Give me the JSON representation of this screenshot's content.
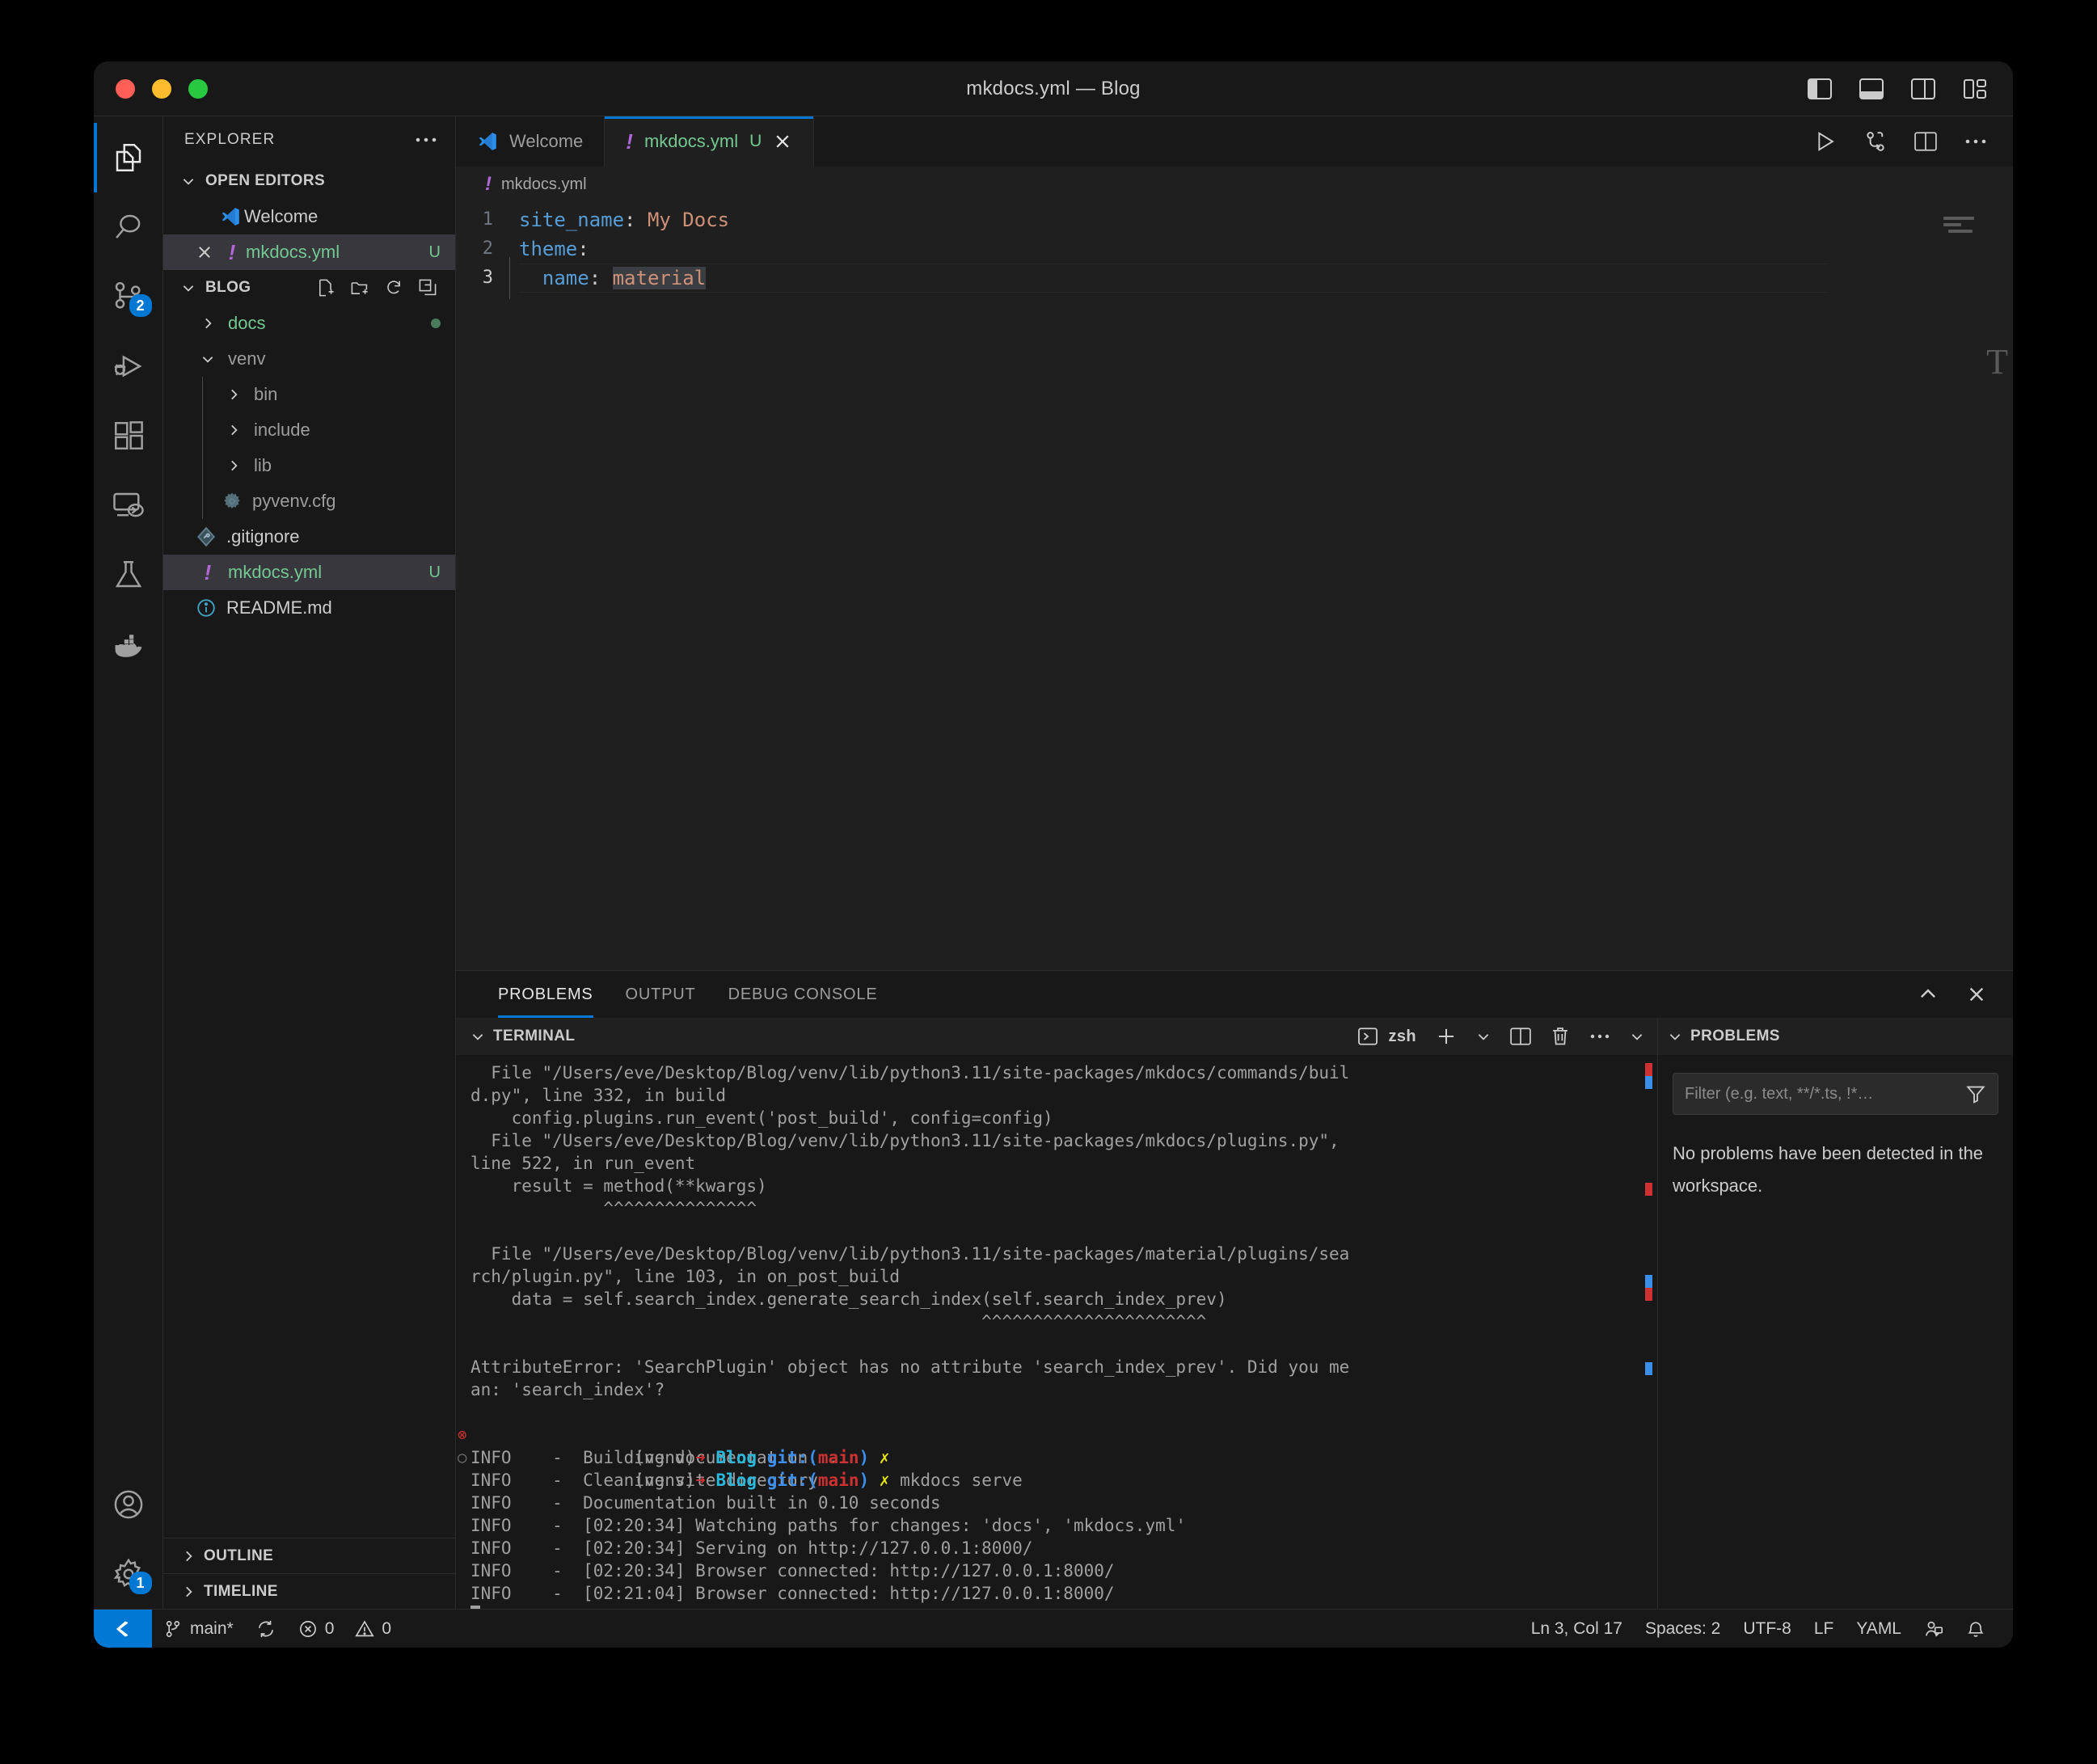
{
  "window": {
    "title": "mkdocs.yml — Blog",
    "traffic_lights": [
      "close",
      "minimize",
      "zoom"
    ],
    "layout_actions": [
      "toggle-primary-sidebar",
      "toggle-panel",
      "toggle-secondary-sidebar",
      "customize-layout"
    ]
  },
  "activitybar": {
    "items": [
      {
        "name": "explorer",
        "icon": "files-icon",
        "active": true,
        "badge": ""
      },
      {
        "name": "search",
        "icon": "search-icon",
        "active": false,
        "badge": ""
      },
      {
        "name": "source-control",
        "icon": "source-control-icon",
        "active": false,
        "badge": "2"
      },
      {
        "name": "run-and-debug",
        "icon": "debug-icon",
        "active": false,
        "badge": ""
      },
      {
        "name": "extensions",
        "icon": "extensions-icon",
        "active": false,
        "badge": ""
      },
      {
        "name": "remote-explorer",
        "icon": "remote-icon",
        "active": false,
        "badge": ""
      },
      {
        "name": "testing",
        "icon": "beaker-icon",
        "active": false,
        "badge": ""
      },
      {
        "name": "docker",
        "icon": "docker-icon",
        "active": false,
        "badge": ""
      }
    ],
    "bottom": [
      {
        "name": "accounts",
        "icon": "account-icon",
        "badge": ""
      },
      {
        "name": "manage",
        "icon": "gear-icon",
        "badge": "1"
      }
    ]
  },
  "sidebar": {
    "title": "EXPLORER",
    "more_actions": "…",
    "open_editors": {
      "label": "OPEN EDITORS",
      "expanded": true,
      "items": [
        {
          "label": "Welcome",
          "icon": "vscode-icon",
          "dirty": "",
          "selected": false,
          "close": false
        },
        {
          "label": "mkdocs.yml",
          "icon": "yaml-icon",
          "dirty": "U",
          "selected": true,
          "close": true
        }
      ]
    },
    "workspace": {
      "label": "BLOG",
      "expanded": true,
      "actions": [
        "new-file-icon",
        "new-folder-icon",
        "refresh-icon",
        "collapse-all-icon"
      ],
      "items": [
        {
          "label": "docs",
          "type": "folder",
          "expanded": false,
          "depth": 1,
          "color": "green",
          "decoration": "modified-dot"
        },
        {
          "label": "venv",
          "type": "folder",
          "expanded": true,
          "depth": 1,
          "color": "dim",
          "decoration": ""
        },
        {
          "label": "bin",
          "type": "folder",
          "expanded": false,
          "depth": 2,
          "color": "dim",
          "decoration": ""
        },
        {
          "label": "include",
          "type": "folder",
          "expanded": false,
          "depth": 2,
          "color": "dim",
          "decoration": ""
        },
        {
          "label": "lib",
          "type": "folder",
          "expanded": false,
          "depth": 2,
          "color": "dim",
          "decoration": ""
        },
        {
          "label": "pyvenv.cfg",
          "type": "file",
          "icon": "gear-file-icon",
          "depth": 2,
          "color": "dim",
          "decoration": ""
        },
        {
          "label": ".gitignore",
          "type": "file",
          "icon": "git-file-icon",
          "depth": 1,
          "color": "normal",
          "decoration": ""
        },
        {
          "label": "mkdocs.yml",
          "type": "file",
          "icon": "yaml-icon",
          "depth": 1,
          "color": "green",
          "decoration": "U",
          "selected": true
        },
        {
          "label": "README.md",
          "type": "file",
          "icon": "info-file-icon",
          "depth": 1,
          "color": "normal",
          "decoration": ""
        }
      ]
    },
    "collapsed_sections": [
      {
        "label": "OUTLINE"
      },
      {
        "label": "TIMELINE"
      }
    ]
  },
  "editor": {
    "tabs": [
      {
        "label": "Welcome",
        "icon": "vscode-icon",
        "active": false,
        "dirty": "",
        "closable": false
      },
      {
        "label": "mkdocs.yml",
        "icon": "yaml-icon",
        "active": true,
        "dirty": "U",
        "closable": true
      }
    ],
    "actions": [
      "run-icon",
      "split-merge-icon",
      "split-editor-icon",
      "more-actions-icon"
    ],
    "breadcrumb": {
      "icon": "yaml-icon",
      "path": "mkdocs.yml"
    },
    "lines": [
      {
        "num": "1",
        "tokens": [
          {
            "text": "site_name",
            "cls": "k-key"
          },
          {
            "text": ": ",
            "cls": "k-punc"
          },
          {
            "text": "My Docs",
            "cls": "k-str"
          }
        ]
      },
      {
        "num": "2",
        "tokens": [
          {
            "text": "theme",
            "cls": "k-key"
          },
          {
            "text": ":",
            "cls": "k-punc"
          }
        ]
      },
      {
        "num": "3",
        "tokens": [
          {
            "text": "  ",
            "cls": "k-punc"
          },
          {
            "text": "name",
            "cls": "k-key"
          },
          {
            "text": ": ",
            "cls": "k-punc"
          },
          {
            "text": "material",
            "cls": "k-str sel"
          }
        ]
      }
    ]
  },
  "panel": {
    "tabs": [
      {
        "label": "PROBLEMS",
        "active": true
      },
      {
        "label": "OUTPUT",
        "active": false
      },
      {
        "label": "DEBUG CONSOLE",
        "active": false
      }
    ],
    "actions": [
      "chevron-up-icon",
      "close-icon"
    ],
    "terminal": {
      "header_label": "TERMINAL",
      "shell_label": "zsh",
      "header_actions": [
        "new-terminal-icon",
        "terminal-dropdown-icon",
        "split-terminal-icon",
        "kill-terminal-icon",
        "more-actions-icon",
        "hide-panel-icon"
      ],
      "lines": [
        "  File \"/Users/eve/Desktop/Blog/venv/lib/python3.11/site-packages/mkdocs/commands/buil",
        "d.py\", line 332, in build",
        "    config.plugins.run_event('post_build', config=config)",
        "  File \"/Users/eve/Desktop/Blog/venv/lib/python3.11/site-packages/mkdocs/plugins.py\",",
        "line 522, in run_event",
        "    result = method(**kwargs)",
        "             ^^^^^^^^^^^^^^^",
        "",
        "  File \"/Users/eve/Desktop/Blog/venv/lib/python3.11/site-packages/material/plugins/sea",
        "rch/plugin.py\", line 103, in on_post_build",
        "    data = self.search_index.generate_search_index(self.search_index_prev)",
        "                                                  ^^^^^^^^^^^^^^^^^^^^^^",
        "",
        "AttributeError: 'SearchPlugin' object has no attribute 'search_index_prev'. Did you me",
        "an: 'search_index'?"
      ],
      "prompts": [
        {
          "gutter": "error",
          "venv": "(venv)",
          "arrow": "➜",
          "dir": "Blog",
          "git": " git:(",
          "branch": "main",
          "gitend": ")",
          "flag": "✗",
          "command": ""
        },
        {
          "gutter": "pending",
          "venv": "(venv)",
          "arrow": "➜",
          "dir": "Blog",
          "git": " git:(",
          "branch": "main",
          "gitend": ")",
          "flag": "✗",
          "command": " mkdocs serve"
        }
      ],
      "info_lines": [
        "INFO    -  Building documentation...",
        "INFO    -  Cleaning site directory",
        "INFO    -  Documentation built in 0.10 seconds",
        "INFO    -  [02:20:34] Watching paths for changes: 'docs', 'mkdocs.yml'",
        "INFO    -  [02:20:34] Serving on http://127.0.0.1:8000/",
        "INFO    -  [02:20:34] Browser connected: http://127.0.0.1:8000/",
        "INFO    -  [02:21:04] Browser connected: http://127.0.0.1:8000/"
      ]
    },
    "problems": {
      "header_label": "PROBLEMS",
      "filter_placeholder": "Filter (e.g. text, **/*.ts, !*…",
      "filter_value": "",
      "empty_message": "No problems have been detected in the workspace."
    }
  },
  "statusbar": {
    "remote_icon": "remote-indicator-icon",
    "left": [
      {
        "name": "branch",
        "icon": "git-branch-icon",
        "label": "main*"
      },
      {
        "name": "sync",
        "icon": "sync-icon",
        "label": ""
      },
      {
        "name": "errors",
        "icon": "error-icon",
        "label": "0"
      },
      {
        "name": "warnings",
        "icon": "warning-icon",
        "label": "0"
      }
    ],
    "right": [
      {
        "name": "cursor-position",
        "label": "Ln 3, Col 17"
      },
      {
        "name": "indentation",
        "label": "Spaces: 2"
      },
      {
        "name": "encoding",
        "label": "UTF-8"
      },
      {
        "name": "eol",
        "label": "LF"
      },
      {
        "name": "language-mode",
        "label": "YAML"
      },
      {
        "name": "live-share",
        "icon": "live-share-icon",
        "label": ""
      },
      {
        "name": "notifications",
        "icon": "bell-icon",
        "label": ""
      }
    ]
  },
  "colors": {
    "accent": "#0078d4",
    "green": "#73c991",
    "string": "#ce9178",
    "key": "#569cd6",
    "error": "#cd3131"
  }
}
